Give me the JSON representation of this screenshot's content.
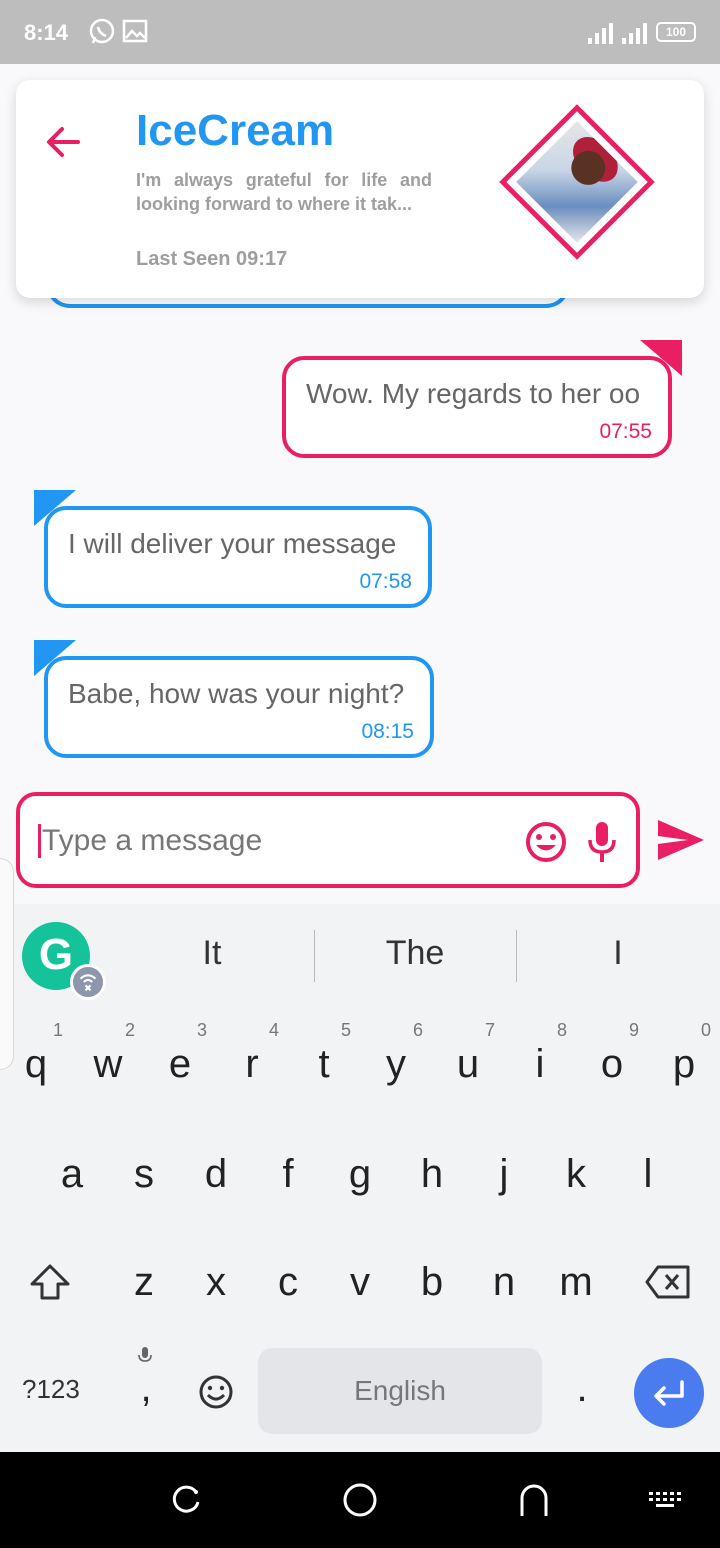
{
  "status_bar": {
    "time": "8:14",
    "battery": "100",
    "icons": [
      "whatsapp-icon",
      "gallery-icon",
      "signal-icon",
      "signal-icon",
      "battery-icon"
    ]
  },
  "header": {
    "back_icon": "arrow-left-icon",
    "name": "IceCream",
    "status": "I'm always grateful for life and looking forward to where it tak...",
    "last_seen": "Last Seen 09:17",
    "avatar": "contact-avatar"
  },
  "messages": [
    {
      "direction": "outgoing",
      "text": "Wow. My regards to her oo",
      "time": "07:55"
    },
    {
      "direction": "incoming",
      "text": "I will deliver your message",
      "time": "07:58"
    },
    {
      "direction": "incoming",
      "text": "Babe, how was your night?",
      "time": "08:15"
    }
  ],
  "composer": {
    "placeholder": "Type a message",
    "emoji_icon": "smiley-icon",
    "mic_icon": "microphone-icon",
    "send_icon": "send-icon"
  },
  "keyboard": {
    "suggestions": [
      "It",
      "The",
      "I"
    ],
    "row1": [
      "q",
      "w",
      "e",
      "r",
      "t",
      "y",
      "u",
      "i",
      "o",
      "p"
    ],
    "row1_hints": [
      "1",
      "2",
      "3",
      "4",
      "5",
      "6",
      "7",
      "8",
      "9",
      "0"
    ],
    "row2": [
      "a",
      "s",
      "d",
      "f",
      "g",
      "h",
      "j",
      "k",
      "l"
    ],
    "row3": [
      "z",
      "x",
      "c",
      "v",
      "b",
      "n",
      "m"
    ],
    "symbols_key": "?123",
    "comma_key": ",",
    "period_key": ".",
    "space_label": "English"
  },
  "colors": {
    "accent_pink": "#e91e63",
    "accent_blue": "#2196f3",
    "status_bar": "#bdbdbd",
    "enter_key": "#4a7cf0",
    "grammarly": "#15c39a"
  }
}
